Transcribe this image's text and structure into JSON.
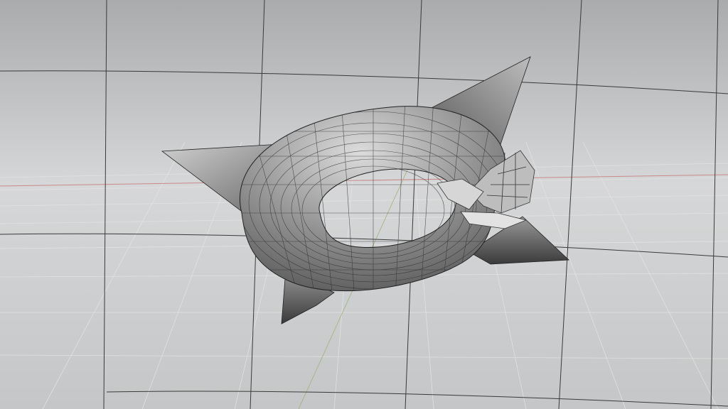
{
  "scene": {
    "subject": "spiked-torus-wireframe",
    "colors": {
      "background_top": "#a9abad",
      "background_mid": "#d6d7d8",
      "background_bottom": "#c4c6c7",
      "major_grid": "#3a3a3a",
      "minor_grid": "#e4e4e4",
      "axis_red": "#c98a8a",
      "axis_green": "#9db17a",
      "mesh_light": "#d9d9d9",
      "mesh_dark": "#4a4a4a",
      "wire": "#2b2b2b"
    }
  }
}
